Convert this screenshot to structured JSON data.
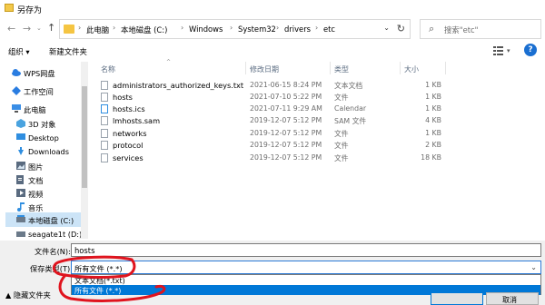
{
  "window": {
    "title": "另存为"
  },
  "address": {
    "crumbs": [
      "此电脑",
      "本地磁盘 (C:)",
      "Windows",
      "System32",
      "drivers",
      "etc"
    ]
  },
  "search": {
    "placeholder": "搜索\"etc\""
  },
  "toolbar": {
    "organize": "组织 ▾",
    "new_folder": "新建文件夹",
    "help": "?"
  },
  "nav": {
    "items": [
      {
        "label": "WPS网盘",
        "icon": "cloud-icon",
        "color": "#2a7de1"
      },
      {
        "label": "工作空间",
        "icon": "workspace-icon",
        "color": "#2a7de1"
      },
      {
        "label": "此电脑",
        "icon": "computer-icon",
        "color": "#3a8ee6"
      },
      {
        "label": "3D 对象",
        "icon": "cube-icon",
        "color": "#4aa3df"
      },
      {
        "label": "Desktop",
        "icon": "desktop-icon",
        "color": "#2f8ee0"
      },
      {
        "label": "Downloads",
        "icon": "download-icon",
        "color": "#2f8ee0"
      },
      {
        "label": "图片",
        "icon": "pictures-icon",
        "color": "#5a6b80"
      },
      {
        "label": "文档",
        "icon": "documents-icon",
        "color": "#5a6b80"
      },
      {
        "label": "视频",
        "icon": "video-icon",
        "color": "#5a6b80"
      },
      {
        "label": "音乐",
        "icon": "music-icon",
        "color": "#2f8ee0"
      },
      {
        "label": "本地磁盘 (C:)",
        "icon": "drive-icon",
        "color": "#6b7a8a"
      },
      {
        "label": "seagate1t (D:)",
        "icon": "drive-icon",
        "color": "#6b7a8a"
      }
    ]
  },
  "columns": {
    "name": "名称",
    "date": "修改日期",
    "type": "类型",
    "size": "大小"
  },
  "files": [
    {
      "name": "administrators_authorized_keys.txt",
      "date": "2021-06-15 8:24 PM",
      "type": "文本文档",
      "size": "1 KB"
    },
    {
      "name": "hosts",
      "date": "2021-07-10 5:22 PM",
      "type": "文件",
      "size": "1 KB"
    },
    {
      "name": "hosts.ics",
      "date": "2021-07-11 9:29 AM",
      "type": "Calendar",
      "size": "1 KB"
    },
    {
      "name": "lmhosts.sam",
      "date": "2019-12-07 5:12 PM",
      "type": "SAM 文件",
      "size": "4 KB"
    },
    {
      "name": "networks",
      "date": "2019-12-07 5:12 PM",
      "type": "文件",
      "size": "1 KB"
    },
    {
      "name": "protocol",
      "date": "2019-12-07 5:12 PM",
      "type": "文件",
      "size": "2 KB"
    },
    {
      "name": "services",
      "date": "2019-12-07 5:12 PM",
      "type": "文件",
      "size": "18 KB"
    }
  ],
  "bottom": {
    "filename_label": "文件名(N):",
    "filename_value": "hosts",
    "filetype_label": "保存类型(T):",
    "filetype_value": "所有文件  (*.*)",
    "options": [
      "文本文档(*.txt)",
      "所有文件  (*.*)"
    ],
    "hide_folders": "▲ 隐藏文件夹",
    "cancel": "取消"
  },
  "colors": {
    "accent": "#0078d7",
    "annotation": "#e0141e"
  }
}
